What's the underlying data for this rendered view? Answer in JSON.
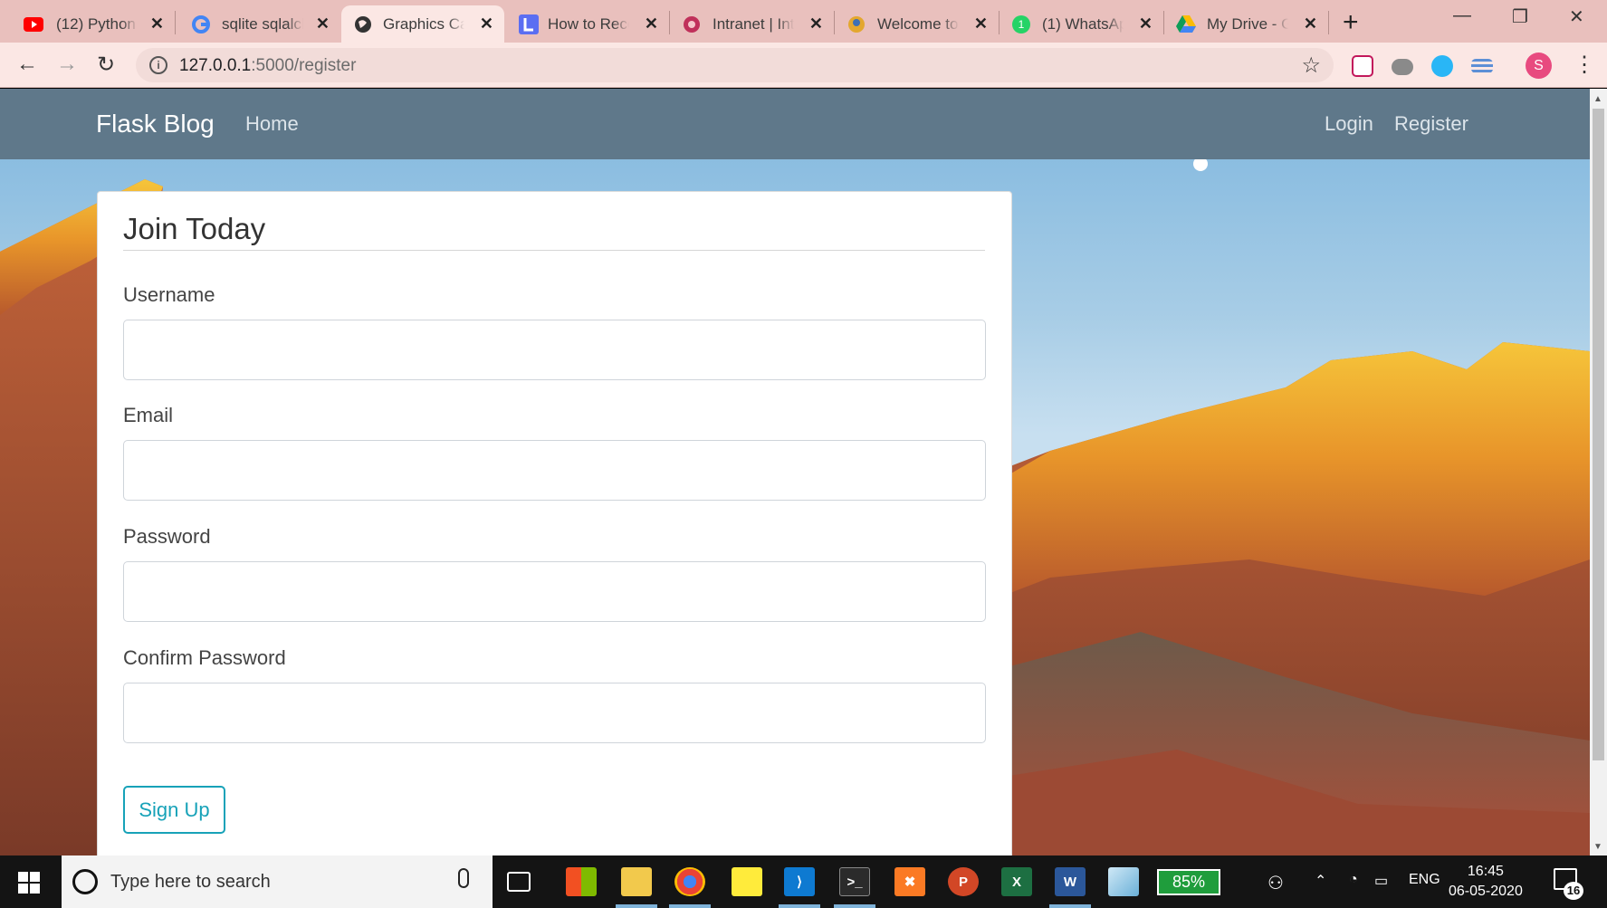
{
  "browser": {
    "tabs": [
      {
        "label": "(12) Python",
        "icon": "youtube-icon"
      },
      {
        "label": "sqlite sqlalch",
        "icon": "google-icon"
      },
      {
        "label": "Graphics Car",
        "icon": "globe-icon"
      },
      {
        "label": "How to Reco",
        "icon": "lucidchart-icon"
      },
      {
        "label": "Intranet | Int",
        "icon": "intranet-icon"
      },
      {
        "label": "Welcome to",
        "icon": "welcome-icon"
      },
      {
        "label": "(1) WhatsAp",
        "icon": "whatsapp-icon"
      },
      {
        "label": "My Drive - G",
        "icon": "google-drive-icon"
      }
    ],
    "active_tab_index": 2,
    "url_host": "127.0.0.1",
    "url_path": ":5000/register",
    "profile_initial": "S"
  },
  "site": {
    "brand": "Flask Blog",
    "nav_left": [
      "Home"
    ],
    "nav_right": [
      "Login",
      "Register"
    ]
  },
  "form": {
    "legend": "Join Today",
    "fields": [
      {
        "label": "Username",
        "value": ""
      },
      {
        "label": "Email",
        "value": ""
      },
      {
        "label": "Password",
        "value": ""
      },
      {
        "label": "Confirm Password",
        "value": ""
      }
    ],
    "submit_label": "Sign Up"
  },
  "taskbar": {
    "search_placeholder": "Type here to search",
    "battery": "85%",
    "language": "ENG",
    "time": "16:45",
    "date": "06-05-2020",
    "notification_count": "16"
  },
  "colors": {
    "navbar": "#5f788a",
    "accent": "#17a2b8",
    "tabbar": "#e9c0bd"
  }
}
